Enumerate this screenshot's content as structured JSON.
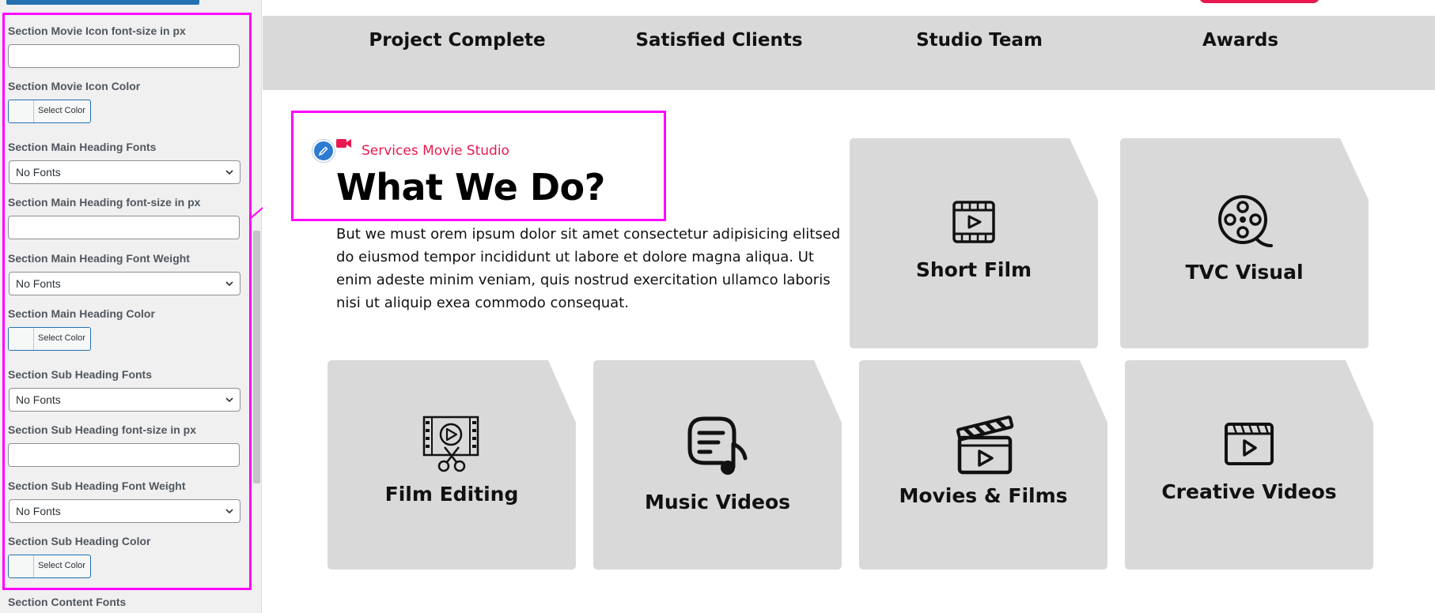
{
  "panel": {
    "fields": [
      {
        "label": "Section Movie Icon font-size in px",
        "value": ""
      },
      {
        "label": "Section Movie Icon Color",
        "button": "Select Color"
      },
      {
        "label": "Section Main Heading Fonts",
        "selected": "No Fonts"
      },
      {
        "label": "Section Main Heading font-size in px",
        "value": ""
      },
      {
        "label": "Section Main Heading Font Weight",
        "selected": "No Fonts"
      },
      {
        "label": "Section Main Heading Color",
        "button": "Select Color"
      },
      {
        "label": "Section Sub Heading Fonts",
        "selected": "No Fonts"
      },
      {
        "label": "Section Sub Heading font-size in px",
        "value": ""
      },
      {
        "label": "Section Sub Heading Font Weight",
        "selected": "No Fonts"
      },
      {
        "label": "Section Sub Heading Color",
        "button": "Select Color"
      },
      {
        "label": "Section Content Fonts"
      }
    ]
  },
  "stats": [
    "Project Complete",
    "Satisfied Clients",
    "Studio Team",
    "Awards"
  ],
  "section": {
    "subheading": "Services Movie Studio",
    "heading": "What We Do?",
    "content": "But we must orem ipsum dolor sit amet consectetur adipisicing elitsed do eiusmod tempor incididunt ut labore et dolore magna aliqua. Ut enim adeste minim veniam, quis nostrud exercitation ullamco laboris nisi ut aliquip exea commodo consequat."
  },
  "cards": [
    {
      "title": "Short Film",
      "icon": "film-frame-play-icon"
    },
    {
      "title": "TVC Visual",
      "icon": "film-reel-icon"
    },
    {
      "title": "Film Editing",
      "icon": "film-strip-scissors-icon"
    },
    {
      "title": "Music Videos",
      "icon": "music-note-document-icon"
    },
    {
      "title": "Movies & Films",
      "icon": "clapperboard-icon"
    },
    {
      "title": "Creative Videos",
      "icon": "video-player-icon"
    }
  ],
  "colors": {
    "accent": "#e8194f",
    "highlight": "#ff00ff",
    "card_bg": "#d9d9d9",
    "panel_bg": "#f0f0f1",
    "wp_blue": "#2271b1"
  }
}
